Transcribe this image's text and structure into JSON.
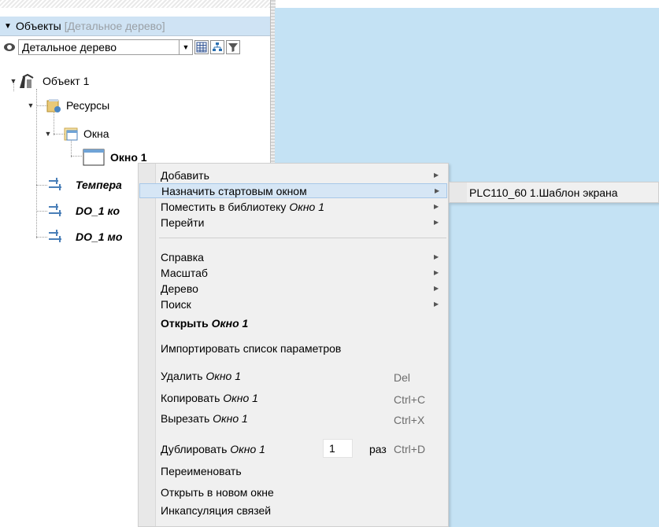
{
  "panel": {
    "title": "Объекты",
    "title_hint": "[Детальное дерево]",
    "view_combo": "Детальное дерево"
  },
  "tree": {
    "object": "Объект 1",
    "resources": "Ресурсы",
    "windows": "Окна",
    "window1": "Окно 1",
    "item_temp": "Темпера",
    "item_do1": "DO_1 ко",
    "item_do2": "DO_1 мо"
  },
  "menu": {
    "add": "Добавить",
    "set_start": "Назначить стартовым окном",
    "to_library": "Поместить в библиотеку",
    "to_library_obj": "Окно 1",
    "goto": "Перейти",
    "help": "Справка",
    "zoom": "Масштаб",
    "tree": "Дерево",
    "search": "Поиск",
    "open": "Открыть",
    "open_obj": "Окно 1",
    "import_params": "Импортировать список параметров",
    "delete": "Удалить",
    "delete_obj": "Окно 1",
    "delete_sc": "Del",
    "copy": "Копировать",
    "copy_obj": "Окно 1",
    "copy_sc": "Ctrl+C",
    "cut": "Вырезать",
    "cut_obj": "Окно 1",
    "cut_sc": "Ctrl+X",
    "duplicate": "Дублировать",
    "duplicate_obj": "Окно 1",
    "duplicate_count": "1",
    "duplicate_times": "раз",
    "duplicate_sc": "Ctrl+D",
    "rename": "Переименовать",
    "open_new": "Открыть в новом окне",
    "encapsulate": "Инкапсуляция связей"
  },
  "submenu": {
    "item": "PLC110_60 1.Шаблон экрана"
  },
  "colors": {
    "canvas": "#c4e2f4",
    "titlebar": "#cfe3f4",
    "menu_bg": "#f0f0f0",
    "menu_highlight": "#d6e6f5"
  }
}
